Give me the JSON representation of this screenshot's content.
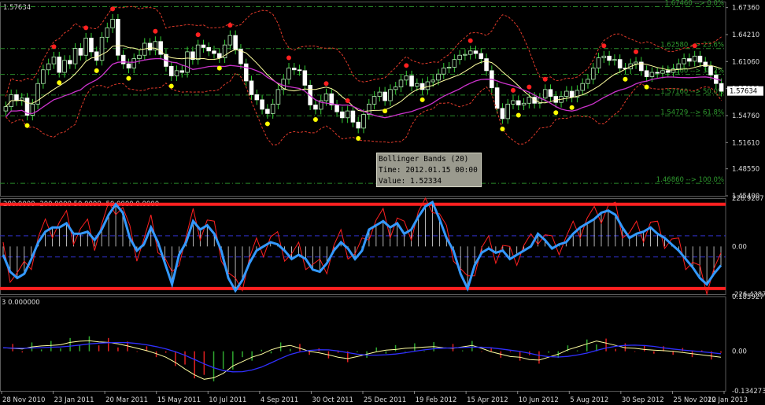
{
  "chart_data": [
    {
      "type": "candlestick",
      "panel": "price",
      "symbol_price": "1.57634",
      "current_price_label": "1.57634",
      "y_ticks": [
        "1.67360",
        "1.64210",
        "1.61060",
        "1.57910",
        "1.54760",
        "1.51610",
        "1.48550",
        "1.45400"
      ],
      "ylim": [
        1.454,
        1.6806
      ],
      "fib_levels": [
        {
          "label": "1.67460 --> 0.0%",
          "value": 1.6746
        },
        {
          "label": "1.62580 --> 23.6%",
          "value": 1.6258
        },
        {
          "label": "1.59560 --> 38.2%",
          "value": 1.5956
        },
        {
          "label": "1.57160 --> 50.0%",
          "value": 1.5716
        },
        {
          "label": "1.54729 --> 61.8%",
          "value": 1.54729
        },
        {
          "label": "1.46860 --> 100.0%",
          "value": 1.4686
        }
      ],
      "overlays": [
        "Bollinger Bands (20)",
        "Moving Average",
        "Fractals"
      ],
      "tooltip": {
        "line1": "Bollinger Bands (20)",
        "line2": "Time: 2012.01.15 00:00",
        "line3": "Value: 1.52334"
      },
      "colors": {
        "up": "#b8f0b8",
        "down": "#ffffff",
        "wick": "#33cc33",
        "bb_outer": "#e03a2a",
        "bb_mid": "#ffffa0",
        "ma": "#cc33cc",
        "fib": "#2a8a2a",
        "frac_up": "#ff2020",
        "frac_down": "#ffff00"
      }
    },
    {
      "type": "line",
      "panel": "cci",
      "header": "200.0000 -200.0000 50.0000 -50.0000 0.0000",
      "y_ticks": [
        "228.9207",
        "0.00",
        "-226.4387"
      ],
      "ylim": [
        -226.4387,
        228.9207
      ],
      "levels": [
        200,
        50,
        -50,
        -200
      ],
      "colors": {
        "main": "#3399ff",
        "signal": "#ff2020",
        "levels": "#ff2020",
        "dash": "#3030cc"
      }
    },
    {
      "type": "histogram",
      "panel": "oscillator",
      "header": "3 0.000000",
      "y_ticks": [
        "0.185927",
        "0.00",
        "-0.134273"
      ],
      "ylim": [
        -0.134273,
        0.185927
      ],
      "colors": {
        "pos": "#2fa52f",
        "neg": "#e02020",
        "line1": "#ffffa0",
        "line2": "#3030ff"
      }
    }
  ],
  "x_axis": [
    "28 Nov 2010",
    "23 Jan 2011",
    "20 Mar 2011",
    "15 May 2011",
    "10 Jul 2011",
    "4 Sep 2011",
    "30 Oct 2011",
    "25 Dec 2011",
    "19 Feb 2012",
    "15 Apr 2012",
    "10 Jun 2012",
    "5 Aug 2012",
    "30 Sep 2012",
    "25 Nov 2012",
    "20 Jan 2013"
  ],
  "closes": [
    1.558,
    1.572,
    1.565,
    1.568,
    1.548,
    1.561,
    1.585,
    1.601,
    1.608,
    1.616,
    1.598,
    1.612,
    1.608,
    1.626,
    1.618,
    1.638,
    1.622,
    1.612,
    1.639,
    1.65,
    1.66,
    1.618,
    1.608,
    1.603,
    1.614,
    1.618,
    1.632,
    1.624,
    1.634,
    1.619,
    1.605,
    1.594,
    1.6,
    1.598,
    1.622,
    1.613,
    1.63,
    1.627,
    1.623,
    1.62,
    1.615,
    1.63,
    1.641,
    1.625,
    1.608,
    1.588,
    1.572,
    1.566,
    1.555,
    1.55,
    1.561,
    1.578,
    1.59,
    1.603,
    1.601,
    1.6,
    1.583,
    1.56,
    1.555,
    1.565,
    1.573,
    1.56,
    1.552,
    1.545,
    1.553,
    1.54,
    1.533,
    1.549,
    1.561,
    1.57,
    1.575,
    1.565,
    1.578,
    1.581,
    1.589,
    1.594,
    1.582,
    1.585,
    1.578,
    1.587,
    1.589,
    1.596,
    1.603,
    1.604,
    1.613,
    1.618,
    1.619,
    1.623,
    1.62,
    1.614,
    1.6,
    1.58,
    1.556,
    1.544,
    1.561,
    1.565,
    1.56,
    1.562,
    1.569,
    1.562,
    1.568,
    1.578,
    1.57,
    1.563,
    1.57,
    1.576,
    1.569,
    1.577,
    1.585,
    1.59,
    1.603,
    1.615,
    1.617,
    1.612,
    1.613,
    1.603,
    1.602,
    1.608,
    1.61,
    1.6,
    1.593,
    1.598,
    1.597,
    1.6,
    1.598,
    1.602,
    1.608,
    1.614,
    1.611,
    1.617,
    1.61,
    1.605,
    1.595,
    1.585,
    1.576
  ],
  "cci": [
    -40,
    -120,
    -150,
    -130,
    -60,
    20,
    70,
    90,
    90,
    110,
    60,
    60,
    70,
    30,
    80,
    150,
    200,
    160,
    40,
    -20,
    10,
    90,
    20,
    -80,
    -180,
    -40,
    20,
    120,
    80,
    100,
    60,
    -20,
    -150,
    -210,
    -160,
    -80,
    -20,
    0,
    20,
    10,
    -20,
    -60,
    -40,
    -60,
    -110,
    -120,
    -80,
    -20,
    20,
    -10,
    -60,
    -20,
    80,
    100,
    120,
    90,
    110,
    60,
    80,
    140,
    190,
    210,
    130,
    40,
    -20,
    -130,
    -200,
    -90,
    -30,
    -10,
    -30,
    -20,
    -60,
    -40,
    -20,
    0,
    60,
    30,
    -10,
    10,
    20,
    60,
    90,
    110,
    130,
    160,
    170,
    150,
    90,
    40,
    60,
    70,
    90,
    60,
    40,
    10,
    -20,
    -60,
    -100,
    -150,
    -180,
    -130,
    -90
  ],
  "osc": [
    0.012,
    0.01,
    0.008,
    0.015,
    0.018,
    0.02,
    0.022,
    0.03,
    0.034,
    0.036,
    0.032,
    0.03,
    0.025,
    0.018,
    0.01,
    0.002,
    -0.008,
    -0.02,
    -0.038,
    -0.06,
    -0.08,
    -0.095,
    -0.09,
    -0.075,
    -0.05,
    -0.035,
    -0.02,
    -0.01,
    0.005,
    0.015,
    0.02,
    0.01,
    0.0,
    -0.005,
    -0.012,
    -0.02,
    -0.025,
    -0.018,
    -0.01,
    -0.002,
    0.004,
    0.006,
    0.01,
    0.012,
    0.014,
    0.016,
    0.012,
    0.01,
    0.015,
    0.02,
    0.01,
    -0.002,
    -0.01,
    -0.018,
    -0.02,
    -0.028,
    -0.03,
    -0.02,
    -0.01,
    0.005,
    0.015,
    0.025,
    0.035,
    0.028,
    0.02,
    0.012,
    0.01,
    0.006,
    0.004,
    0.002,
    0.0,
    -0.004,
    -0.008,
    -0.012,
    -0.016,
    -0.02
  ]
}
